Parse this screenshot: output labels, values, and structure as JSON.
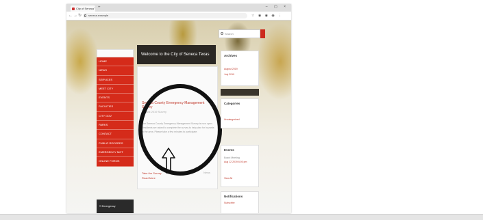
{
  "browser": {
    "tab_title": "City of Seneca",
    "tab_close": "×",
    "new_tab": "+",
    "window_controls": "– ▢ ×",
    "nav_buttons": [
      "←",
      "→",
      "↻"
    ],
    "address": "seneca.example",
    "extension_icons": "☆ ◉ ◉ ◉ ⋮"
  },
  "site": {
    "search_placeholder": "Search",
    "welcome_banner": "Welcome to the City of Seneca Texas",
    "menu_items": [
      "HOME",
      "NEWS",
      "SERVICES",
      "MEET CITY",
      "EVENTS",
      "FACILITIES",
      "CITY GOV",
      "PARKS",
      "CONTACT",
      "PUBLIC RECORDS",
      "EMERGENCY MGT",
      "ONLINE FORMS"
    ],
    "bottom_box": "≡ Emergency",
    "article": {
      "title": "Seneca County Emergency Management Survey",
      "date": "August 2019 Survey",
      "body": "The Seneca County Emergency Management Survey is now open. Residents are asked to complete the survey to help plan for hazards in the area. Please take a few minutes to participate.",
      "read_more": "Take the Survey",
      "read_more_2": "Read More",
      "meta": "News"
    },
    "sidebar": {
      "archive_title": "Archives",
      "archive_links": [
        "August 2019",
        "July 2019"
      ],
      "categories_title": "Categories",
      "categories_links": [
        "Uncategorized"
      ],
      "events_title": "Events",
      "events_text": [
        "Board Meeting",
        "Aug 12 2019 6:00 pm"
      ],
      "events_more": "View All",
      "updates_title": "Notifications",
      "updates_link": "Subscribe"
    }
  },
  "colors": {
    "accent_red": "#d52b1a",
    "highlight_circle": "#111111"
  },
  "icons": {
    "search": "search-icon",
    "arrow": "up-arrow-annotation-icon",
    "lock": "lock-icon"
  }
}
